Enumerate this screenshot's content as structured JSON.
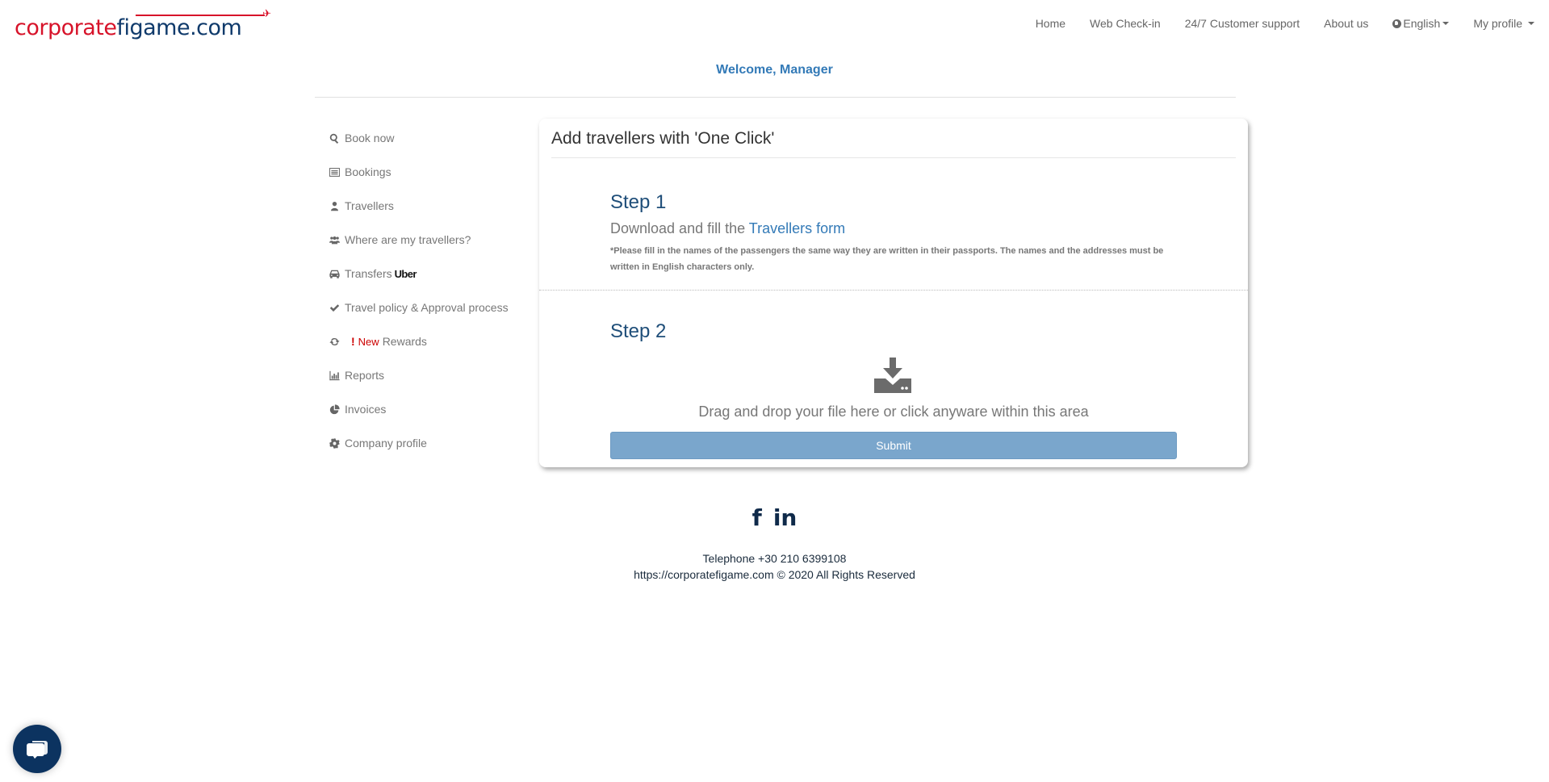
{
  "brand": {
    "logo_part1": "corporate",
    "logo_part2": "figame.com",
    "red": "#d7132a",
    "navy": "#0f3a6b"
  },
  "nav": {
    "items": [
      {
        "label": "Home"
      },
      {
        "label": "Web Check-in"
      },
      {
        "label": "24/7 Customer support"
      },
      {
        "label": "About us"
      },
      {
        "label": "English",
        "icon": "globe-icon",
        "dropdown": true
      },
      {
        "label": "My profile",
        "dropdown": true
      }
    ]
  },
  "welcome": "Welcome, Manager",
  "sidebar": {
    "items": [
      {
        "label": "Book now",
        "icon": "search-icon"
      },
      {
        "label": "Bookings",
        "icon": "list-icon"
      },
      {
        "label": "Travellers",
        "icon": "user-icon"
      },
      {
        "label": "Where are my travellers?",
        "icon": "users-icon"
      },
      {
        "label": "Transfers",
        "icon": "car-icon",
        "suffix": "Uber"
      },
      {
        "label": "Travel policy & Approval process",
        "icon": "check-icon"
      },
      {
        "label": "Rewards",
        "icon": "refresh-icon",
        "badge_mark": "!",
        "badge_text": "New"
      },
      {
        "label": "Reports",
        "icon": "bar-chart-icon"
      },
      {
        "label": "Invoices",
        "icon": "pie-chart-icon"
      },
      {
        "label": "Company profile",
        "icon": "gear-icon"
      }
    ]
  },
  "card": {
    "title": "Add travellers with 'One Click'",
    "step1": {
      "title": "Step 1",
      "text": "Download and fill the ",
      "link": "Travellers form",
      "note": "*Please fill in the names of the passengers the same way they are written in their passports. The names and the addresses must be written in English characters only."
    },
    "step2": {
      "title": "Step 2",
      "drop_text": "Drag and drop your file here or click anyware within this area",
      "submit_label": "Submit"
    }
  },
  "footer": {
    "social": [
      {
        "name": "facebook",
        "glyph": "f"
      },
      {
        "name": "linkedin",
        "glyph": "in"
      }
    ],
    "telephone": "Telephone +30 210 6399108",
    "copyright": "https://corporatefigame.com © 2020 All Rights Reserved"
  }
}
